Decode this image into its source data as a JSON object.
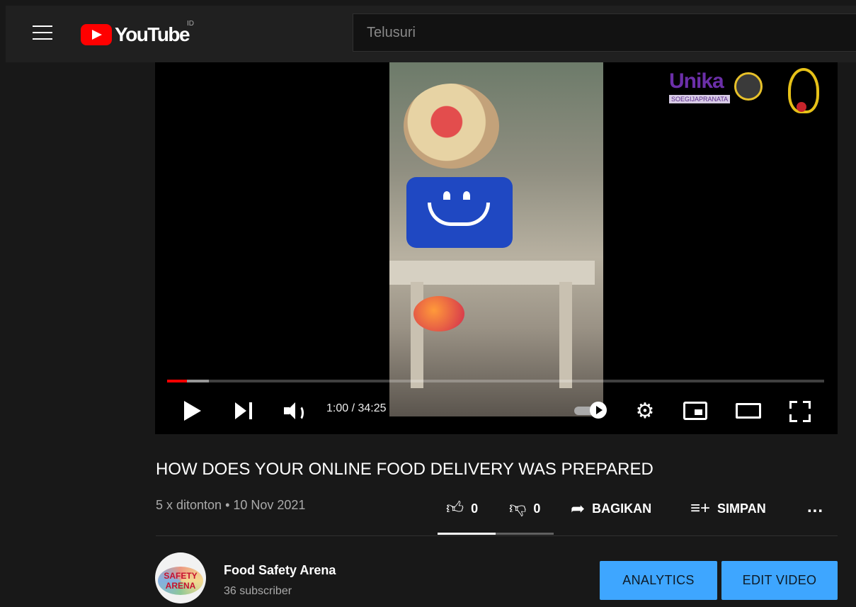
{
  "header": {
    "logo_text": "YouTube",
    "region": "ID",
    "search_placeholder": "Telusuri"
  },
  "player": {
    "overlay_brand": {
      "logo_text": "Unika",
      "subtitle": "SOEGIJAPRANATA"
    },
    "progress": {
      "played_fraction": 0.03,
      "buffered_fraction": 0.064
    },
    "time_display": "1:00 / 34:25",
    "controls": {
      "play_icon": "play-icon",
      "next_icon": "next-icon",
      "volume_icon": "volume-icon",
      "autoplay_icon": "autoplay-toggle",
      "settings_icon": "gear-icon",
      "miniplayer_icon": "miniplayer-icon",
      "theater_icon": "theater-icon",
      "fullscreen_icon": "fullscreen-icon"
    }
  },
  "video": {
    "title": "HOW DOES YOUR ONLINE FOOD DELIVERY WAS PREPARED",
    "meta": "5 x ditonton • 10 Nov 2021"
  },
  "actions": {
    "like_count": "0",
    "dislike_count": "0",
    "share_label": "BAGIKAN",
    "save_label": "SIMPAN",
    "more_label": "...",
    "sentiment_fraction": 0.5
  },
  "channel": {
    "name": "Food Safety Arena",
    "subscribers": "36 subscriber",
    "avatar_text_1": "SAFETY",
    "avatar_text_2": "ARENA"
  },
  "buttons": {
    "analytics": "ANALYTICS",
    "edit_video": "EDIT VIDEO"
  },
  "colors": {
    "accent": "#ff0000",
    "button": "#3ea6ff",
    "background": "#181818"
  }
}
